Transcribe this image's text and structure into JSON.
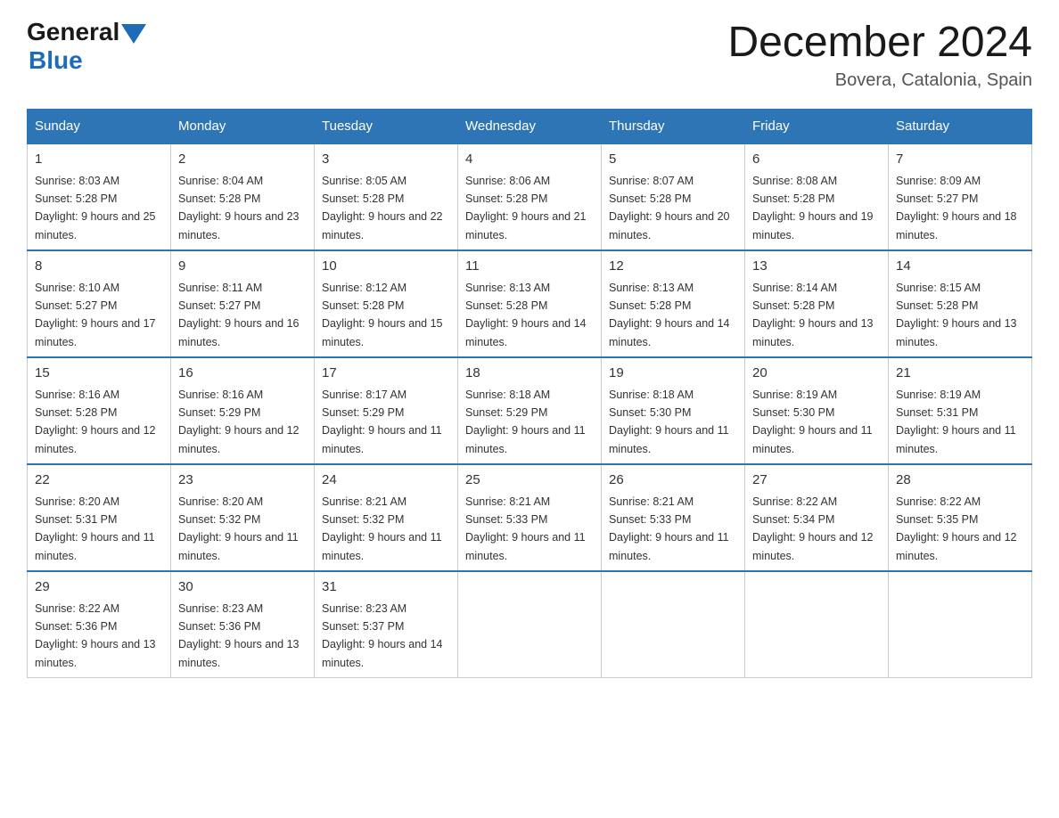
{
  "logo": {
    "general": "General",
    "blue": "Blue"
  },
  "title": "December 2024",
  "location": "Bovera, Catalonia, Spain",
  "days_of_week": [
    "Sunday",
    "Monday",
    "Tuesday",
    "Wednesday",
    "Thursday",
    "Friday",
    "Saturday"
  ],
  "weeks": [
    [
      {
        "day": "1",
        "sunrise": "8:03 AM",
        "sunset": "5:28 PM",
        "daylight": "9 hours and 25 minutes."
      },
      {
        "day": "2",
        "sunrise": "8:04 AM",
        "sunset": "5:28 PM",
        "daylight": "9 hours and 23 minutes."
      },
      {
        "day": "3",
        "sunrise": "8:05 AM",
        "sunset": "5:28 PM",
        "daylight": "9 hours and 22 minutes."
      },
      {
        "day": "4",
        "sunrise": "8:06 AM",
        "sunset": "5:28 PM",
        "daylight": "9 hours and 21 minutes."
      },
      {
        "day": "5",
        "sunrise": "8:07 AM",
        "sunset": "5:28 PM",
        "daylight": "9 hours and 20 minutes."
      },
      {
        "day": "6",
        "sunrise": "8:08 AM",
        "sunset": "5:28 PM",
        "daylight": "9 hours and 19 minutes."
      },
      {
        "day": "7",
        "sunrise": "8:09 AM",
        "sunset": "5:27 PM",
        "daylight": "9 hours and 18 minutes."
      }
    ],
    [
      {
        "day": "8",
        "sunrise": "8:10 AM",
        "sunset": "5:27 PM",
        "daylight": "9 hours and 17 minutes."
      },
      {
        "day": "9",
        "sunrise": "8:11 AM",
        "sunset": "5:27 PM",
        "daylight": "9 hours and 16 minutes."
      },
      {
        "day": "10",
        "sunrise": "8:12 AM",
        "sunset": "5:28 PM",
        "daylight": "9 hours and 15 minutes."
      },
      {
        "day": "11",
        "sunrise": "8:13 AM",
        "sunset": "5:28 PM",
        "daylight": "9 hours and 14 minutes."
      },
      {
        "day": "12",
        "sunrise": "8:13 AM",
        "sunset": "5:28 PM",
        "daylight": "9 hours and 14 minutes."
      },
      {
        "day": "13",
        "sunrise": "8:14 AM",
        "sunset": "5:28 PM",
        "daylight": "9 hours and 13 minutes."
      },
      {
        "day": "14",
        "sunrise": "8:15 AM",
        "sunset": "5:28 PM",
        "daylight": "9 hours and 13 minutes."
      }
    ],
    [
      {
        "day": "15",
        "sunrise": "8:16 AM",
        "sunset": "5:28 PM",
        "daylight": "9 hours and 12 minutes."
      },
      {
        "day": "16",
        "sunrise": "8:16 AM",
        "sunset": "5:29 PM",
        "daylight": "9 hours and 12 minutes."
      },
      {
        "day": "17",
        "sunrise": "8:17 AM",
        "sunset": "5:29 PM",
        "daylight": "9 hours and 11 minutes."
      },
      {
        "day": "18",
        "sunrise": "8:18 AM",
        "sunset": "5:29 PM",
        "daylight": "9 hours and 11 minutes."
      },
      {
        "day": "19",
        "sunrise": "8:18 AM",
        "sunset": "5:30 PM",
        "daylight": "9 hours and 11 minutes."
      },
      {
        "day": "20",
        "sunrise": "8:19 AM",
        "sunset": "5:30 PM",
        "daylight": "9 hours and 11 minutes."
      },
      {
        "day": "21",
        "sunrise": "8:19 AM",
        "sunset": "5:31 PM",
        "daylight": "9 hours and 11 minutes."
      }
    ],
    [
      {
        "day": "22",
        "sunrise": "8:20 AM",
        "sunset": "5:31 PM",
        "daylight": "9 hours and 11 minutes."
      },
      {
        "day": "23",
        "sunrise": "8:20 AM",
        "sunset": "5:32 PM",
        "daylight": "9 hours and 11 minutes."
      },
      {
        "day": "24",
        "sunrise": "8:21 AM",
        "sunset": "5:32 PM",
        "daylight": "9 hours and 11 minutes."
      },
      {
        "day": "25",
        "sunrise": "8:21 AM",
        "sunset": "5:33 PM",
        "daylight": "9 hours and 11 minutes."
      },
      {
        "day": "26",
        "sunrise": "8:21 AM",
        "sunset": "5:33 PM",
        "daylight": "9 hours and 11 minutes."
      },
      {
        "day": "27",
        "sunrise": "8:22 AM",
        "sunset": "5:34 PM",
        "daylight": "9 hours and 12 minutes."
      },
      {
        "day": "28",
        "sunrise": "8:22 AM",
        "sunset": "5:35 PM",
        "daylight": "9 hours and 12 minutes."
      }
    ],
    [
      {
        "day": "29",
        "sunrise": "8:22 AM",
        "sunset": "5:36 PM",
        "daylight": "9 hours and 13 minutes."
      },
      {
        "day": "30",
        "sunrise": "8:23 AM",
        "sunset": "5:36 PM",
        "daylight": "9 hours and 13 minutes."
      },
      {
        "day": "31",
        "sunrise": "8:23 AM",
        "sunset": "5:37 PM",
        "daylight": "9 hours and 14 minutes."
      },
      null,
      null,
      null,
      null
    ]
  ]
}
